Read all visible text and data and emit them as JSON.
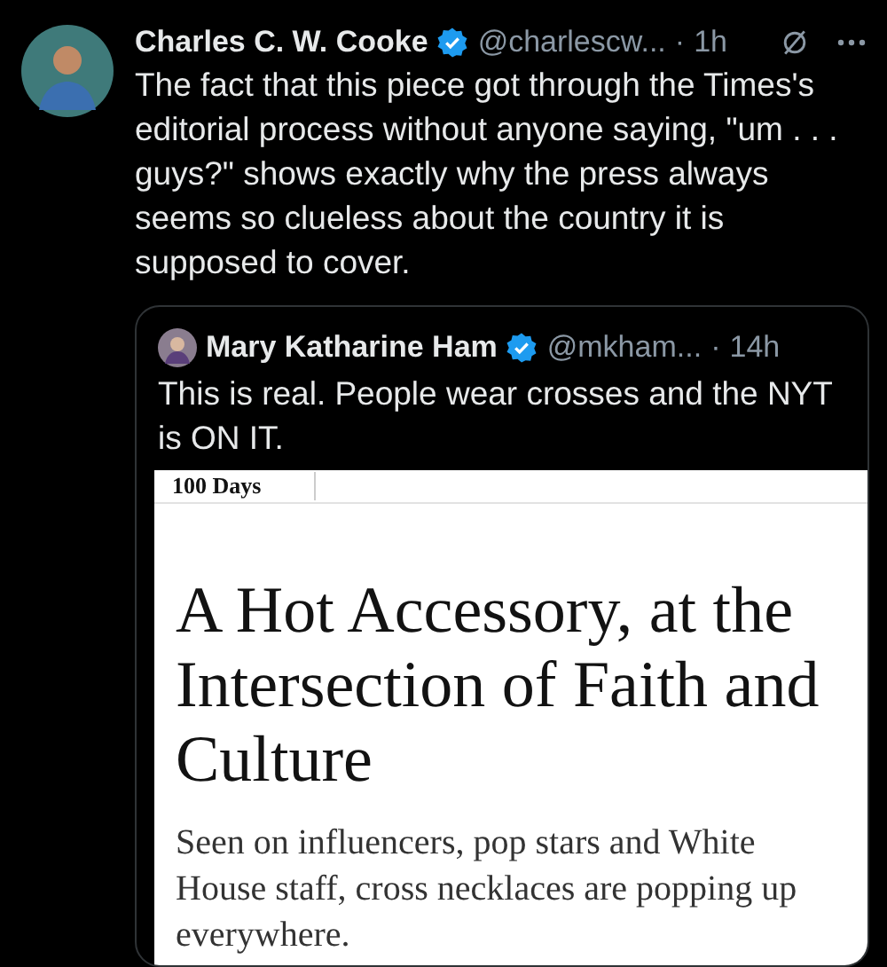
{
  "tweet": {
    "name": "Charles C. W. Cooke",
    "verified": true,
    "handle": "@charlescw...",
    "separator": "·",
    "time": "1h",
    "text": "The fact that this piece got through the Times's editorial process without anyone saying, \"um . . . guys?\" shows exactly why the press always seems so clueless about the country it is supposed to cover.",
    "quote": {
      "name": "Mary Katharine Ham",
      "verified": true,
      "handle": "@mkham...",
      "separator": "·",
      "time": "14h",
      "text": "This is real. People wear crosses and the NYT is ON IT.",
      "article": {
        "section": "100 Days",
        "headline": "A Hot Accessory, at the Intersection of Faith and Culture",
        "summary": "Seen on influencers, pop stars and White House staff, cross necklaces are popping up everywhere."
      }
    }
  }
}
